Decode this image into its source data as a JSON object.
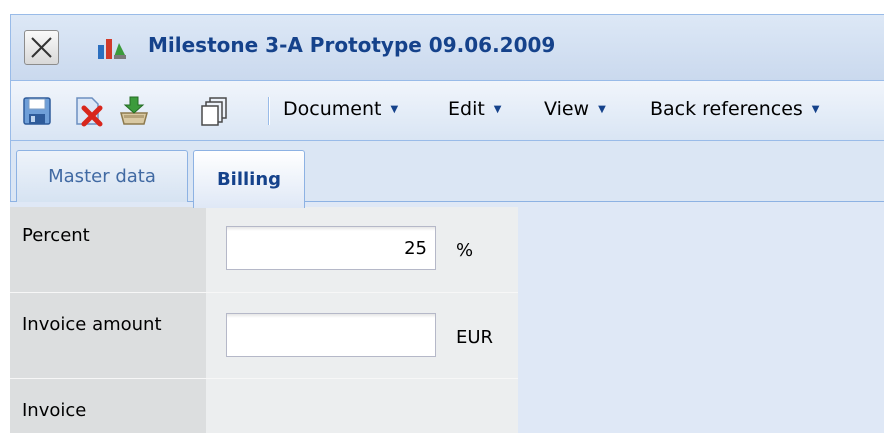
{
  "window": {
    "title": "Milestone 3-A Prototype 09.06.2009"
  },
  "toolbar": {
    "icons": [
      "save-icon",
      "delete-icon",
      "export-icon",
      "copy-icon"
    ],
    "menus": [
      {
        "label": "Document"
      },
      {
        "label": "Edit"
      },
      {
        "label": "View"
      },
      {
        "label": "Back references"
      }
    ]
  },
  "tabs": [
    {
      "label": "Master data",
      "active": false
    },
    {
      "label": "Billing",
      "active": true
    }
  ],
  "form": {
    "percent": {
      "label": "Percent",
      "value": "25",
      "unit": "%"
    },
    "invoice_amount": {
      "label": "Invoice amount",
      "value": "",
      "unit": "EUR"
    },
    "invoice": {
      "label": "Invoice"
    }
  },
  "colors": {
    "title_text": "#15428b",
    "accent_border": "#99bbe8"
  }
}
